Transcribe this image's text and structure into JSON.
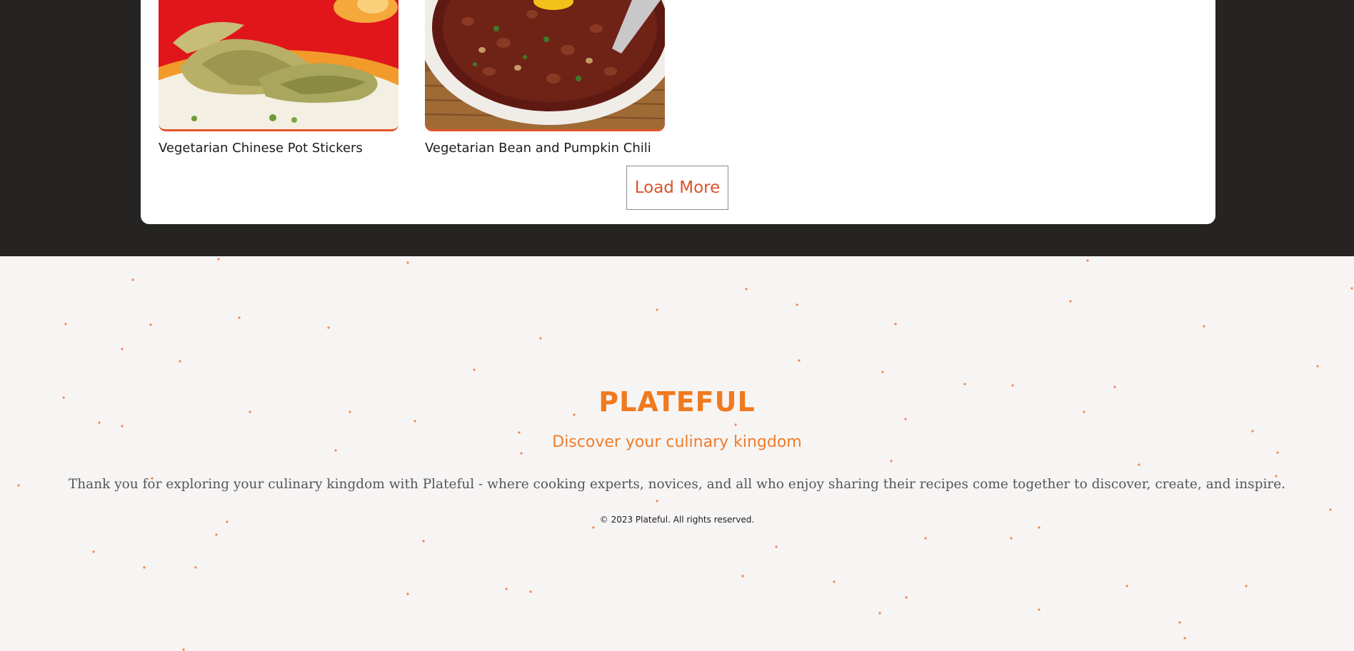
{
  "recipes": [
    {
      "title": "Vegetarian Chinese Pot Stickers",
      "image": "pot-stickers-photo"
    },
    {
      "title": "Vegetarian Bean and Pumpkin Chili",
      "image": "bean-chili-photo"
    }
  ],
  "load_more": {
    "label": "Load More"
  },
  "footer": {
    "brand": "PLATEFUL",
    "tagline": "Discover your culinary kingdom",
    "message": "Thank you for exploring your culinary kingdom with Plateful - where cooking experts, novices, and all who enjoy sharing their recipes come together to discover, create, and inspire.",
    "copyright": "© 2023 Plateful. All rights reserved."
  },
  "colors": {
    "dark_band": "#252423",
    "accent": "#e2552c",
    "brand": "#f07a1e",
    "footer_bg": "#f7f4f4"
  }
}
